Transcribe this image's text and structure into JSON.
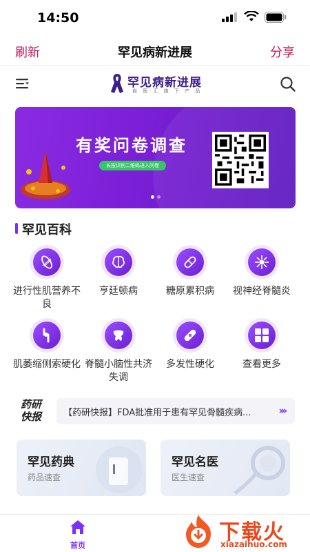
{
  "status": {
    "time": "14:50"
  },
  "navbar": {
    "refresh": "刷新",
    "title": "罕见病新进展",
    "share": "分享"
  },
  "appbar": {
    "logo_name": "罕见病新进展",
    "logo_sub": "自 医 汇 旗 下 产 品"
  },
  "banner": {
    "title": "有奖问卷调查",
    "pill": "长按识别二维码进入问卷",
    "slides": 2,
    "active": 1
  },
  "section": {
    "title": "罕见百科"
  },
  "wiki": [
    {
      "label": "进行性肌营养不良",
      "icon": "muscle-icon"
    },
    {
      "label": "亨廷顿病",
      "icon": "brain-icon"
    },
    {
      "label": "糖原累积病",
      "icon": "pill-icon"
    },
    {
      "label": "视神经脊髓炎",
      "icon": "neuron-icon"
    },
    {
      "label": "肌萎缩侧索硬化",
      "icon": "joint-icon"
    },
    {
      "label": "脊髓小脑性共济失调",
      "icon": "vertebra-icon"
    },
    {
      "label": "多发性硬化",
      "icon": "bandage-icon"
    },
    {
      "label": "查看更多",
      "icon": "grid-icon"
    }
  ],
  "news": {
    "tag_line1": "药研",
    "tag_line2": "快报",
    "text": "【药研快报】FDA批准用于患有罕见骨髓疾病..."
  },
  "cards": [
    {
      "title": "罕见药典",
      "subtitle": "药品速查"
    },
    {
      "title": "罕见名医",
      "subtitle": "医生速查"
    }
  ],
  "tabbar": {
    "home": "首页"
  },
  "watermark": {
    "text": "下载火",
    "url": "xiazaihuo.com"
  }
}
